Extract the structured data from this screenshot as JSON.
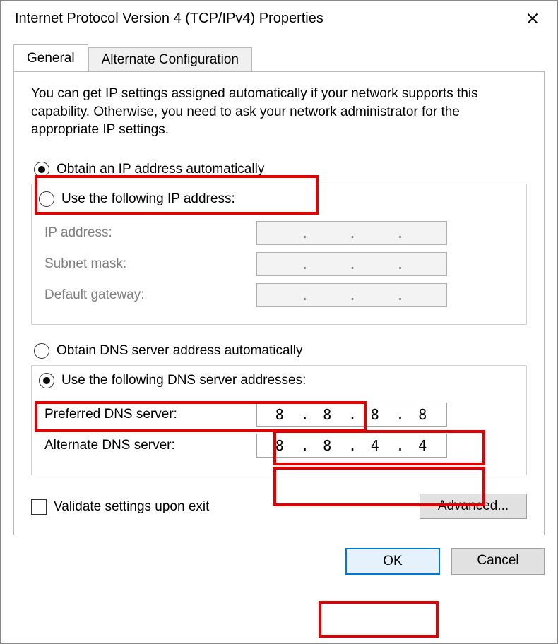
{
  "window": {
    "title": "Internet Protocol Version 4 (TCP/IPv4) Properties"
  },
  "tabs": {
    "general": "General",
    "alternate": "Alternate Configuration"
  },
  "intro_text": "You can get IP settings assigned automatically if your network supports this capability. Otherwise, you need to ask your network administrator for the appropriate IP settings.",
  "ip_section": {
    "obtain_auto_label": "Obtain an IP address automatically",
    "use_following_label": "Use the following IP address:",
    "obtain_auto_selected": true,
    "ip_address_label": "IP address:",
    "subnet_mask_label": "Subnet mask:",
    "default_gateway_label": "Default gateway:",
    "ip_address_value": "",
    "subnet_mask_value": "",
    "default_gateway_value": ""
  },
  "dns_section": {
    "obtain_auto_label": "Obtain DNS server address automatically",
    "use_following_label": "Use the following DNS server addresses:",
    "use_following_selected": true,
    "preferred_label": "Preferred DNS server:",
    "alternate_label": "Alternate DNS server:",
    "preferred_value": {
      "o1": "8",
      "o2": "8",
      "o3": "8",
      "o4": "8"
    },
    "alternate_value": {
      "o1": "8",
      "o2": "8",
      "o3": "4",
      "o4": "4"
    }
  },
  "validate_label": "Validate settings upon exit",
  "validate_checked": false,
  "buttons": {
    "advanced": "Advanced...",
    "ok": "OK",
    "cancel": "Cancel"
  },
  "dot": "."
}
